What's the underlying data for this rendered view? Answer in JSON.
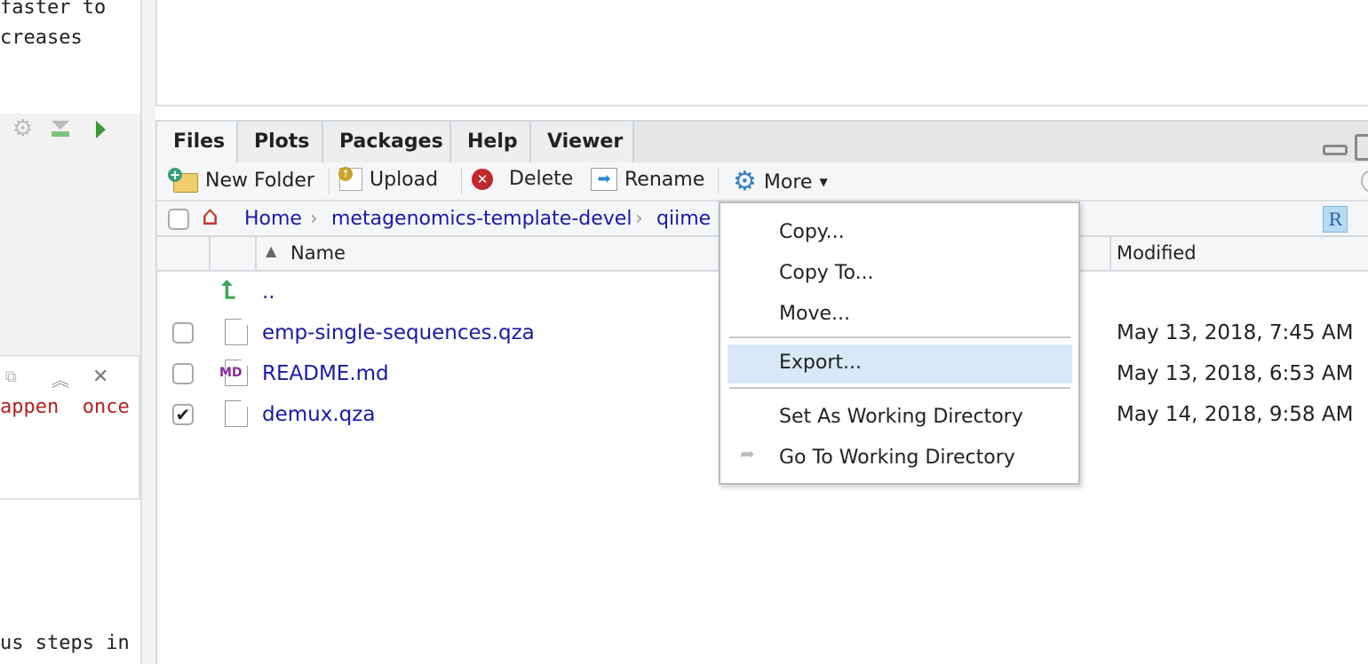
{
  "left": {
    "line1": "faster to",
    "line2": "creases",
    "red_text": "appen  once",
    "bottom_text": "us steps in"
  },
  "tabs": [
    {
      "label": "Files",
      "active": true
    },
    {
      "label": "Plots"
    },
    {
      "label": "Packages"
    },
    {
      "label": "Help"
    },
    {
      "label": "Viewer"
    }
  ],
  "toolbar": {
    "new_folder": "New Folder",
    "upload": "Upload",
    "delete": "Delete",
    "rename": "Rename",
    "more": "More"
  },
  "breadcrumb": [
    "Home",
    "metagenomics-template-devel",
    "qiime"
  ],
  "columns": {
    "name": "Name",
    "modified": "Modified"
  },
  "files": [
    {
      "name": "..",
      "type": "parent"
    },
    {
      "name": "emp-single-sequences.qza",
      "modified": "May 13, 2018, 7:45 AM",
      "checked": false,
      "type": "file"
    },
    {
      "name": "README.md",
      "modified": "May 13, 2018, 6:53 AM",
      "checked": false,
      "type": "md",
      "badge": "MD"
    },
    {
      "name": "demux.qza",
      "modified": "May 14, 2018, 9:58 AM",
      "checked": true,
      "type": "file"
    }
  ],
  "menu": {
    "items": [
      "Copy...",
      "Copy To...",
      "Move...",
      "Export...",
      "Set As Working Directory",
      "Go To Working Directory"
    ],
    "selected": "Export..."
  },
  "colors": {
    "link": "#1a1aa6",
    "selected": "#d9e7f6",
    "red": "#b22222"
  }
}
